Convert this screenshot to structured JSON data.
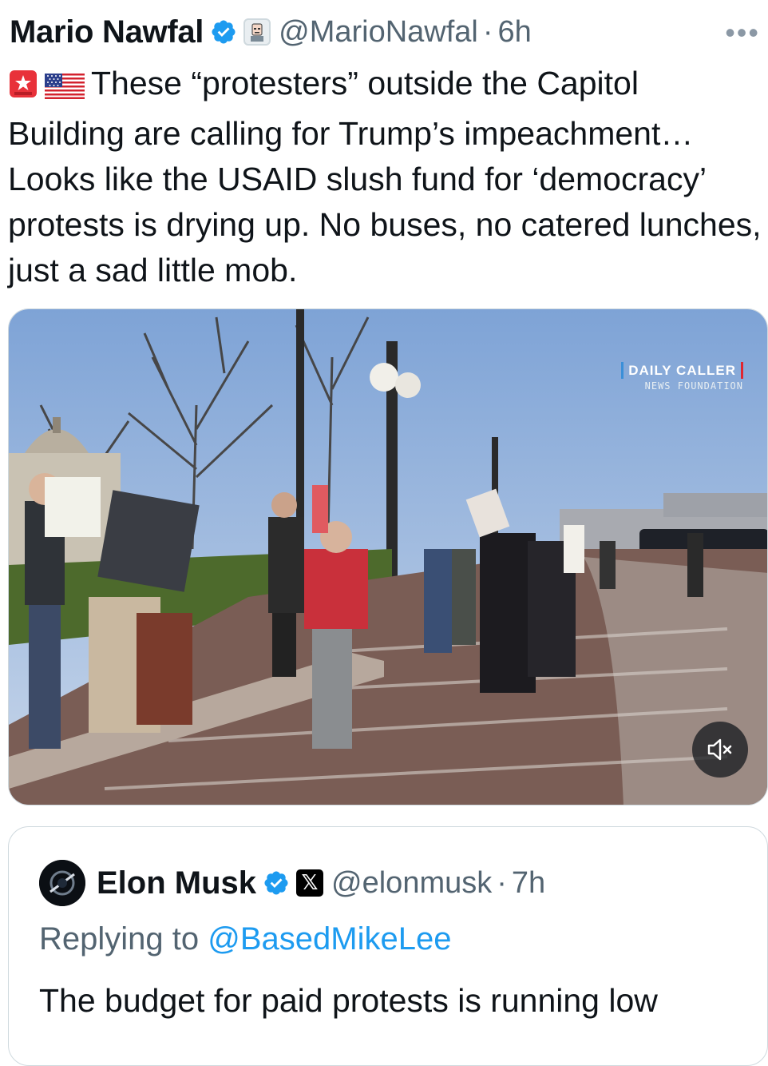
{
  "tweet": {
    "author_name": "Mario Nawfal",
    "handle": "@MarioNawfal",
    "separator": "·",
    "time": "6h",
    "more_label": "•••",
    "emojis": [
      "rotating-light-icon",
      "us-flag-icon"
    ],
    "text": "These “protesters” outside the Capitol Building are calling for Trump’s impeachment… Looks like the USAID slush fund for ‘democracy’ protests is drying up. No buses, no catered lunches, just a sad little mob."
  },
  "media": {
    "watermark_line1": "DAILY CALLER",
    "watermark_line2": "NEWS FOUNDATION",
    "mute_icon": "speaker-muted-icon"
  },
  "quoted_tweet": {
    "author_name": "Elon Musk",
    "handle": "@elonmusk",
    "separator": "·",
    "time": "7h",
    "replying_prefix": "Replying to",
    "replying_handle": "@BasedMikeLee",
    "text": "The budget for paid protests is running low"
  },
  "colors": {
    "verified_blue": "#1d9bf0",
    "secondary_text": "#536471",
    "primary_text": "#0f1419"
  }
}
